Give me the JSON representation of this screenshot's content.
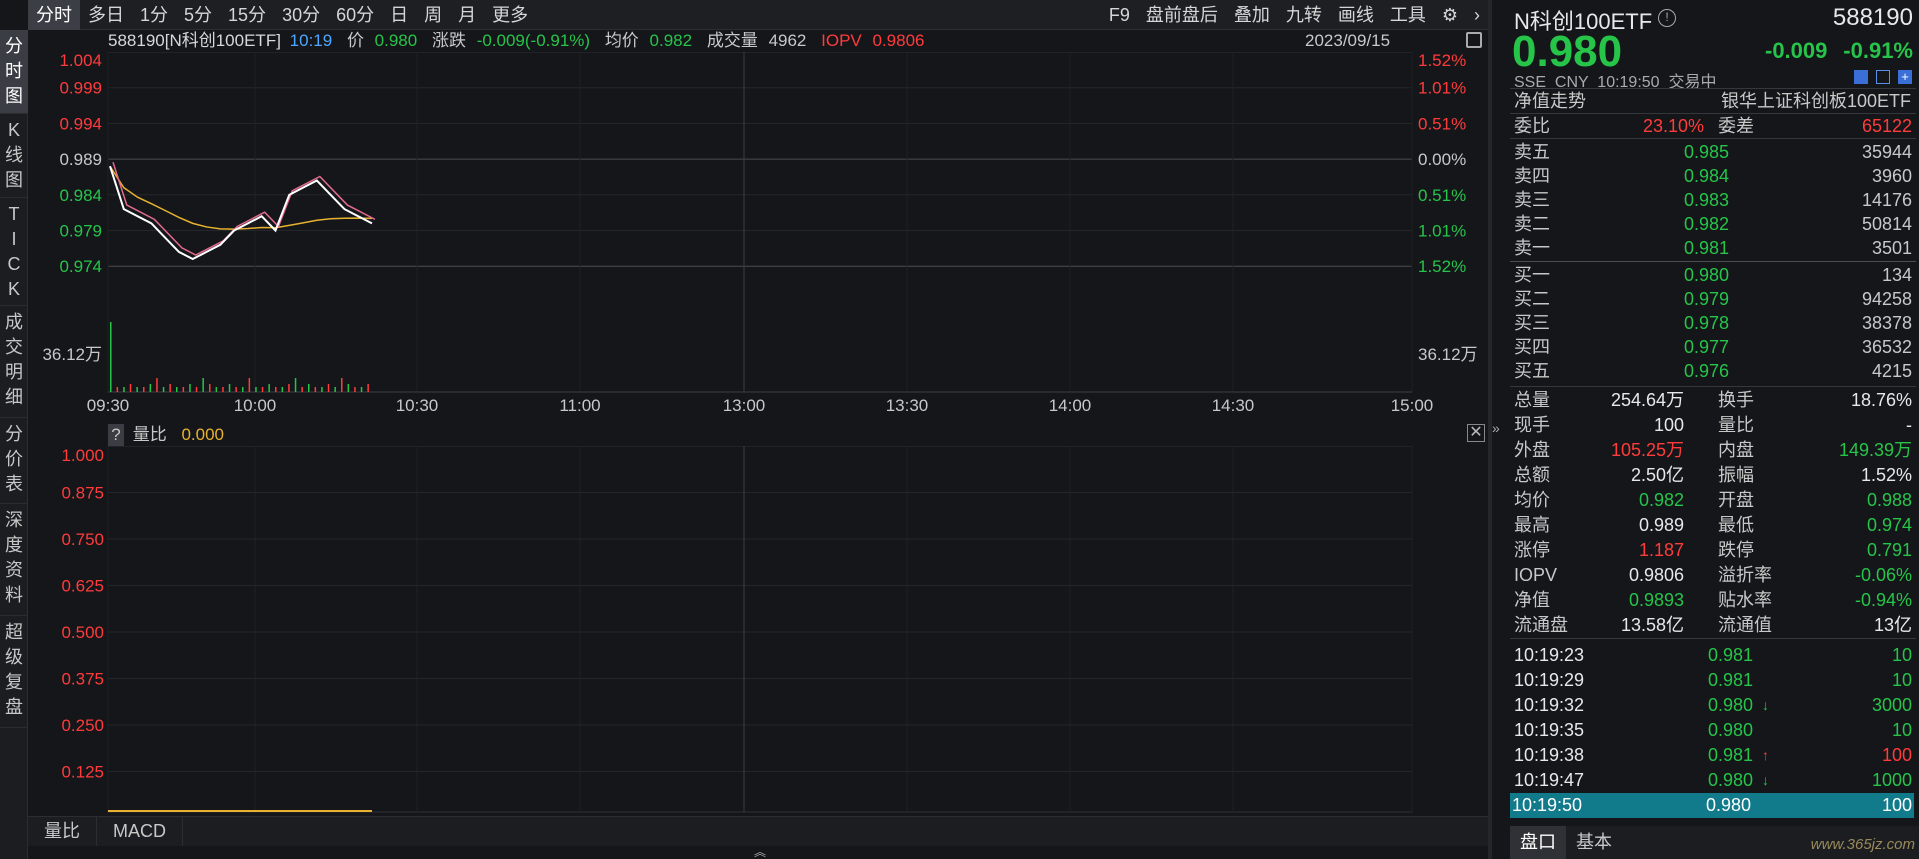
{
  "toolbar": {
    "tabs": [
      "分时",
      "多日",
      "1分",
      "5分",
      "15分",
      "30分",
      "60分",
      "日",
      "周",
      "月",
      "更多"
    ],
    "right": [
      "F9",
      "盘前盘后",
      "叠加",
      "九转",
      "画线",
      "工具"
    ]
  },
  "vtabs": [
    "分\n时\n图",
    "K\n线\n图",
    "T\nI\nC\nK",
    "成\n交\n明\n细",
    "分\n价\n表",
    "深\n度\n资\n料",
    "超\n级\n复\n盘"
  ],
  "header": {
    "code_name": "588190[N科创100ETF]",
    "time": "10:19",
    "price_label": "价",
    "price": "0.980",
    "chg_label": "涨跌",
    "chg": "-0.009(-0.91%)",
    "avg_label": "均价",
    "avg": "0.982",
    "vol_label": "成交量",
    "vol": "4962",
    "iopv_label": "IOPV",
    "iopv": "0.9806",
    "date": "2023/09/15"
  },
  "chart": {
    "y_left": [
      "1.004",
      "0.999",
      "0.994",
      "0.989",
      "0.984",
      "0.979",
      "0.974"
    ],
    "y_right": [
      "1.52%",
      "1.01%",
      "0.51%",
      "0.00%",
      "0.51%",
      "1.01%",
      "1.52%"
    ],
    "vol_left": "36.12万",
    "vol_right": "36.12万",
    "x_labels": [
      "09:30",
      "10:00",
      "10:30",
      "11:00",
      "13:00",
      "13:30",
      "14:00",
      "14:30",
      "15:00"
    ]
  },
  "chart_data": {
    "type": "line",
    "series": [
      {
        "values": [
          0.988,
          0.982,
          0.981,
          0.98,
          0.978,
          0.976,
          0.975,
          0.976,
          0.977,
          0.979,
          0.98,
          0.981,
          0.979,
          0.984,
          0.985,
          0.986,
          0.984,
          0.982,
          0.981,
          0.98
        ]
      }
    ],
    "ylim": [
      0.974,
      1.004
    ]
  },
  "sub": {
    "help": "?",
    "name": "量比",
    "value": "0.000",
    "y": [
      "1.000",
      "0.875",
      "0.750",
      "0.625",
      "0.500",
      "0.375",
      "0.250",
      "0.125"
    ]
  },
  "bottom_tabs": [
    "量比",
    "MACD"
  ],
  "quote": {
    "name": "N科创100ETF",
    "code": "588190",
    "price": "0.980",
    "chg": "-0.009",
    "pct": "-0.91%",
    "market": "SSE  CNY  10:19:50  交易中",
    "nav_trend": "净值走势",
    "fund_name": "银华上证科创板100ETF",
    "wb_label": "委比",
    "wb": "23.10%",
    "wc_label": "委差",
    "wc": "65122"
  },
  "asks": [
    {
      "l": "卖五",
      "p": "0.985",
      "v": "35944"
    },
    {
      "l": "卖四",
      "p": "0.984",
      "v": "3960"
    },
    {
      "l": "卖三",
      "p": "0.983",
      "v": "14176"
    },
    {
      "l": "卖二",
      "p": "0.982",
      "v": "50814"
    },
    {
      "l": "卖一",
      "p": "0.981",
      "v": "3501"
    }
  ],
  "bids": [
    {
      "l": "买一",
      "p": "0.980",
      "v": "134"
    },
    {
      "l": "买二",
      "p": "0.979",
      "v": "94258"
    },
    {
      "l": "买三",
      "p": "0.978",
      "v": "38378"
    },
    {
      "l": "买四",
      "p": "0.977",
      "v": "36532"
    },
    {
      "l": "买五",
      "p": "0.976",
      "v": "4215"
    }
  ],
  "stats": [
    [
      "总量",
      "254.64万",
      "换手",
      "18.76%"
    ],
    [
      "现手",
      "100",
      "量比",
      "-"
    ],
    [
      "外盘",
      "105.25万",
      "内盘",
      "149.39万"
    ],
    [
      "总额",
      "2.50亿",
      "振幅",
      "1.52%"
    ],
    [
      "均价",
      "0.982",
      "开盘",
      "0.988"
    ],
    [
      "最高",
      "0.989",
      "最低",
      "0.974"
    ],
    [
      "涨停",
      "1.187",
      "跌停",
      "0.791"
    ],
    [
      "IOPV",
      "0.9806",
      "溢折率",
      "-0.06%"
    ],
    [
      "净值",
      "0.9893",
      "贴水率",
      "-0.94%"
    ],
    [
      "流通盘",
      "13.58亿",
      "流通值",
      "13亿"
    ]
  ],
  "ticks": [
    [
      "10:19:23",
      "0.981",
      "",
      "10"
    ],
    [
      "10:19:29",
      "0.981",
      "",
      "10"
    ],
    [
      "10:19:32",
      "0.980",
      "↓",
      "3000"
    ],
    [
      "10:19:35",
      "0.980",
      "",
      "10"
    ],
    [
      "10:19:38",
      "0.981",
      "↑",
      "100"
    ],
    [
      "10:19:47",
      "0.980",
      "↓",
      "1000"
    ],
    [
      "10:19:50",
      "0.980",
      "",
      "100"
    ]
  ],
  "right_tabs": [
    "盘口",
    "基本"
  ],
  "watermark": "www.365jz.com"
}
